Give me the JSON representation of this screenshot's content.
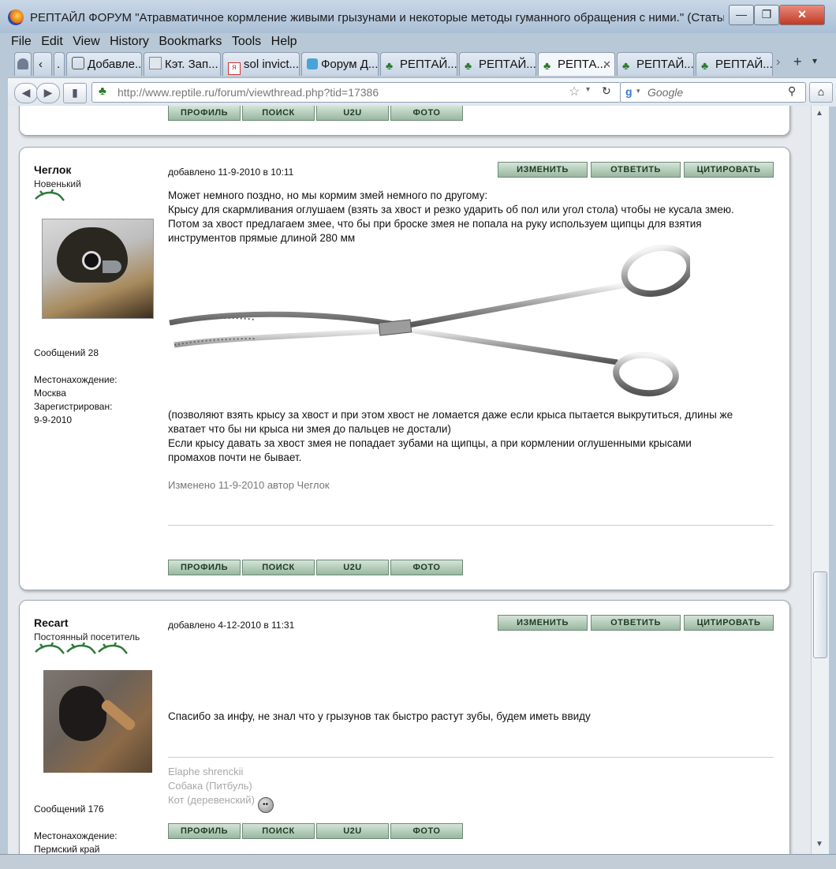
{
  "window": {
    "title": "РЕПТАЙЛ ФОРУМ \"Атравматичное кормление живыми грызунами и некоторые методы гуманного обращения с ними.\" (Статьи...",
    "minimize": "—",
    "maximize": "❐",
    "close": "✕"
  },
  "menu": [
    "File",
    "Edit",
    "View",
    "History",
    "Bookmarks",
    "Tools",
    "Help"
  ],
  "tabs": [
    {
      "label": "Добавле..."
    },
    {
      "label": "Кэт. Зап..."
    },
    {
      "label": "sol invict..."
    },
    {
      "label": "Форум Д..."
    },
    {
      "label": "РЕПТАЙ..."
    },
    {
      "label": "РЕПТАЙ..."
    },
    {
      "label": "РЕПТА..."
    },
    {
      "label": "РЕПТАЙ..."
    },
    {
      "label": "РЕПТАЙ..."
    }
  ],
  "nav": {
    "url_host": "http://www.reptile.ru",
    "url_path": "/forum/viewthread.php?tid=17386",
    "search_placeholder": "Google"
  },
  "buttons": {
    "profile": "ПРОФИЛЬ",
    "search": "ПОИСК",
    "u2u": "U2U",
    "photo": "ФОТО",
    "edit": "ИЗМЕНИТЬ",
    "reply": "ОТВЕТИТЬ",
    "quote": "ЦИТИРОВАТЬ"
  },
  "posts": [
    {
      "username": "Чеглок",
      "rank": "Новенький",
      "rank_icons": 1,
      "posts_count": "Сообщений 28",
      "location_label": "Местонахождение:",
      "location": "Москва",
      "registered_label": "Зарегистрирован:",
      "registered": "9-9-2010",
      "date": "добавлено 11-9-2010 в 10:11",
      "text_lines": [
        "Может немного поздно, но мы кормим змей немного по другому:",
        "Крысу для скармливания оглушаем (взять за хвост и резко ударить об пол или угол стола) чтобы не кусала змею.",
        "Потом за хвост предлагаем змее, что бы при броске змея не попала на руку используем щипцы для взятия",
        "инструментов прямые длиной 280 мм"
      ],
      "text_after": [
        "(позволяют взять крысу за хвост и при этом хвост не ломается даже если крыса пытается выкрутиться, длины же",
        "хватает что бы ни крыса ни змея до пальцев не достали)",
        "Если крысу давать за хвост змея не попадает зубами на щипцы, а при кормлении оглушенными крысами",
        "промахов почти не бывает."
      ],
      "edited": "Изменено 11-9-2010 автор Чеглок"
    },
    {
      "username": "Recart",
      "rank": "Постоянный посетитель",
      "rank_icons": 3,
      "posts_count": "Сообщений 176",
      "location_label": "Местонахождение:",
      "location": "Пермский край",
      "date": "добавлено 4-12-2010 в 11:31",
      "text": "Спасибо за инфу, не знал что у грызунов так быстро растут зубы, будем иметь ввиду",
      "signature": [
        "Elaphe shrenckii",
        "Собака (Питбуль)",
        "Кот (деревенский)"
      ]
    }
  ]
}
